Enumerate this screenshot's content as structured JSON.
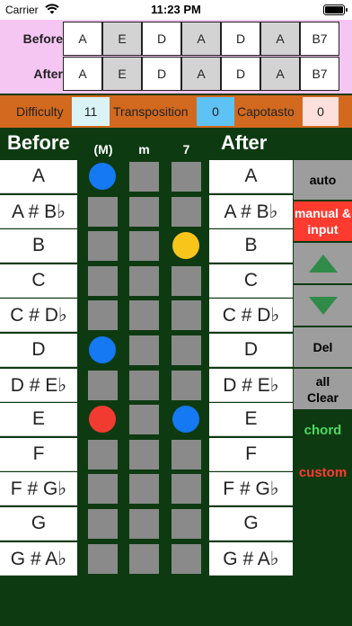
{
  "status_bar": {
    "carrier": "Carrier",
    "time": "11:23 PM"
  },
  "progression": {
    "before_label": "Before",
    "after_label": "After",
    "before_chords": [
      "A",
      "E",
      "D",
      "A",
      "D",
      "A",
      "B7"
    ],
    "after_chords": [
      "A",
      "E",
      "D",
      "A",
      "D",
      "A",
      "B7"
    ]
  },
  "settings": {
    "difficulty_label": "Difficulty",
    "difficulty_value": "11",
    "transposition_label": "Transposition",
    "transposition_value": "0",
    "capotasto_label": "Capotasto",
    "capotasto_value": "0"
  },
  "grid_header": {
    "before": "Before",
    "major": "(M)",
    "minor": "m",
    "seventh": "7",
    "after": "After"
  },
  "notes": [
    {
      "before": "A",
      "after": "A",
      "dots": [
        "blue",
        null,
        null
      ]
    },
    {
      "before": "A # B♭",
      "after": "A # B♭",
      "dots": [
        null,
        null,
        null
      ]
    },
    {
      "before": "B",
      "after": "B",
      "dots": [
        null,
        null,
        "yellow"
      ]
    },
    {
      "before": "C",
      "after": "C",
      "dots": [
        null,
        null,
        null
      ]
    },
    {
      "before": "C # D♭",
      "after": "C # D♭",
      "dots": [
        null,
        null,
        null
      ]
    },
    {
      "before": "D",
      "after": "D",
      "dots": [
        "blue",
        null,
        null
      ]
    },
    {
      "before": "D # E♭",
      "after": "D # E♭",
      "dots": [
        null,
        null,
        null
      ]
    },
    {
      "before": "E",
      "after": "E",
      "dots": [
        "red",
        null,
        "blue"
      ]
    },
    {
      "before": "F",
      "after": "F",
      "dots": [
        null,
        null,
        null
      ]
    },
    {
      "before": "F # G♭",
      "after": "F # G♭",
      "dots": [
        null,
        null,
        null
      ]
    },
    {
      "before": "G",
      "after": "G",
      "dots": [
        null,
        null,
        null
      ]
    },
    {
      "before": "G # A♭",
      "after": "G # A♭",
      "dots": [
        null,
        null,
        null
      ]
    }
  ],
  "dot_colors": {
    "blue": "#1479f2",
    "red": "#f23b30",
    "yellow": "#f8c51b"
  },
  "controls": {
    "auto": "auto",
    "manual_input": "manual & input",
    "up_icon": "triangle-up-icon",
    "down_icon": "triangle-down-icon",
    "del": "Del",
    "all_clear": "all Clear",
    "chord": "chord",
    "custom": "custom"
  },
  "colors": {
    "background": "#0e3a12",
    "progression_panel": "#f6c6f3",
    "settings_strip": "#d2691e",
    "difficulty_value_bg": "#d9f3f7",
    "transposition_value_bg": "#5ec2f5",
    "capotasto_value_bg": "#fde0dc",
    "chord_text": "#4cd964",
    "custom_text": "#ff3b30",
    "arrow_green": "#2f8b47"
  }
}
